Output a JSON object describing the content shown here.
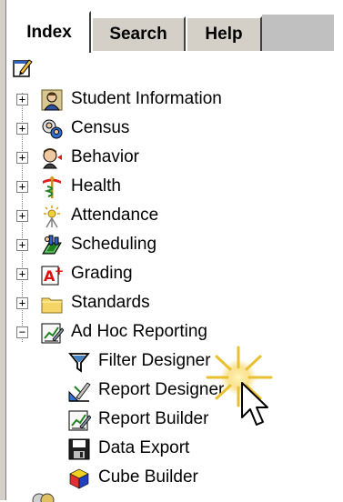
{
  "tabs": [
    {
      "label": "Index",
      "active": true
    },
    {
      "label": "Search",
      "active": false
    },
    {
      "label": "Help",
      "active": false
    }
  ],
  "tree": {
    "root_icon": "notepad-edit-icon",
    "items": [
      {
        "label": "Student Information",
        "icon": "student-icon",
        "expanded": false
      },
      {
        "label": "Census",
        "icon": "census-icon",
        "expanded": false
      },
      {
        "label": "Behavior",
        "icon": "behavior-icon",
        "expanded": false
      },
      {
        "label": "Health",
        "icon": "health-caduceus-icon",
        "expanded": false
      },
      {
        "label": "Attendance",
        "icon": "attendance-icon",
        "expanded": false
      },
      {
        "label": "Scheduling",
        "icon": "scheduling-icon",
        "expanded": false
      },
      {
        "label": "Grading",
        "icon": "grading-a-plus-icon",
        "expanded": false
      },
      {
        "label": "Standards",
        "icon": "folder-icon",
        "expanded": false
      },
      {
        "label": "Ad Hoc Reporting",
        "icon": "adhoc-reporting-icon",
        "expanded": true,
        "children": [
          {
            "label": "Filter Designer",
            "icon": "filter-icon"
          },
          {
            "label": "Report Designer",
            "icon": "report-designer-icon"
          },
          {
            "label": "Report Builder",
            "icon": "report-builder-icon"
          },
          {
            "label": "Data Export",
            "icon": "floppy-disk-icon"
          },
          {
            "label": "Cube Builder",
            "icon": "cube-icon"
          }
        ]
      }
    ]
  },
  "expander": {
    "collapsed": "+",
    "expanded": "−"
  },
  "colors": {
    "tab_face": "#d4d0c8",
    "tab_strip_bg": "#c0c0c0",
    "tree_bg": "#ffffff",
    "folder": "#f5d565",
    "cube_red": "#e03030",
    "cube_blue": "#2040c0",
    "cube_yellow": "#f0d020"
  }
}
